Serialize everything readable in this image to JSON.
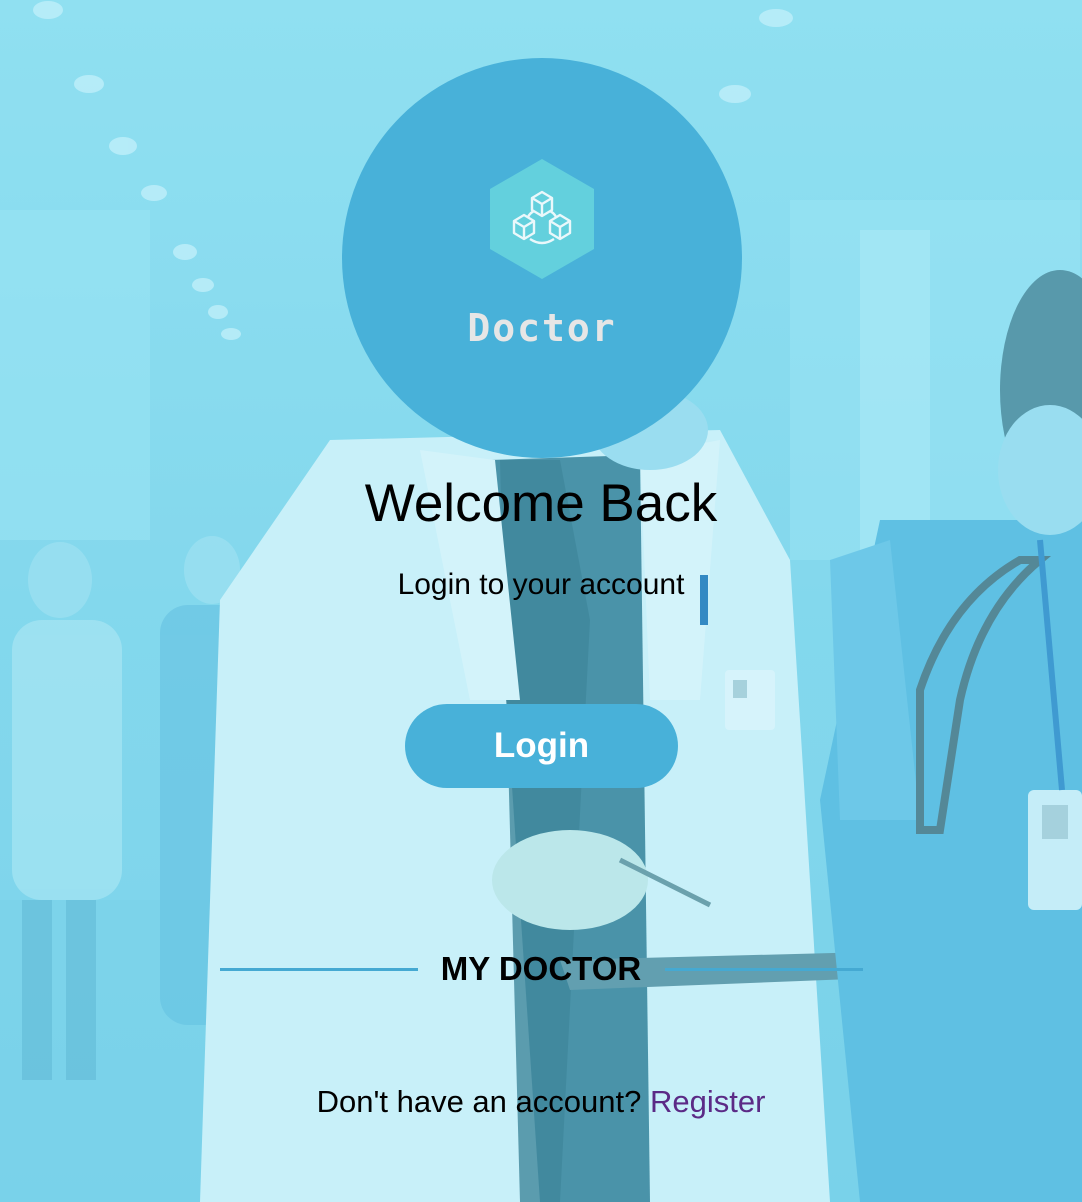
{
  "logo": {
    "brand_name": "Doctor",
    "icon": "cubes-network-icon"
  },
  "header": {
    "title": "Welcome Back",
    "subtitle": "Login to your account"
  },
  "actions": {
    "login_label": "Login"
  },
  "divider": {
    "label": "MY DOCTOR"
  },
  "footer": {
    "prompt": "Don't have an account?",
    "register_label": "Register"
  },
  "colors": {
    "primary": "#48b1d9",
    "background_tint": "#8fdcee",
    "link": "#5b2a86",
    "divider": "#45a9d2"
  }
}
